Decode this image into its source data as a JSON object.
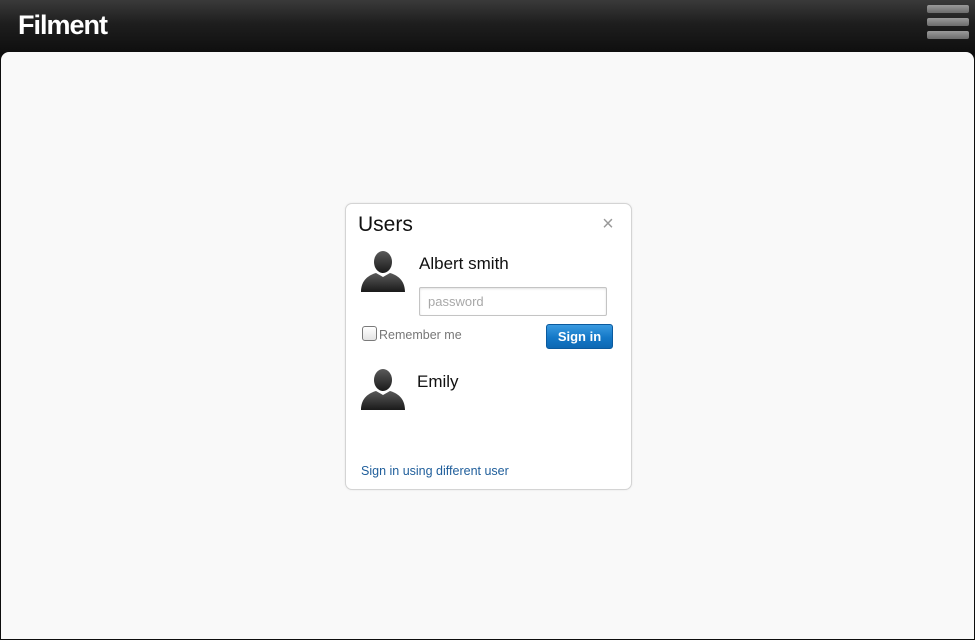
{
  "app": {
    "title": "Filment",
    "menu_icon": "hamburger-menu-icon"
  },
  "dialog": {
    "title": "Users",
    "close_icon": "close-icon",
    "users": [
      {
        "name": "Albert smith",
        "avatar_icon": "user-silhouette-icon"
      },
      {
        "name": "Emily",
        "avatar_icon": "user-silhouette-icon"
      }
    ],
    "password": {
      "value": "",
      "placeholder": "password"
    },
    "remember_me": {
      "label": "Remember me",
      "checked": false
    },
    "signin_label": "Sign in",
    "different_user_label": "Sign in using different user"
  },
  "colors": {
    "topbar": "#1e1e1e",
    "background": "#f9f9f9",
    "signin_button": "#1478c7",
    "link": "#1f5e9b"
  }
}
